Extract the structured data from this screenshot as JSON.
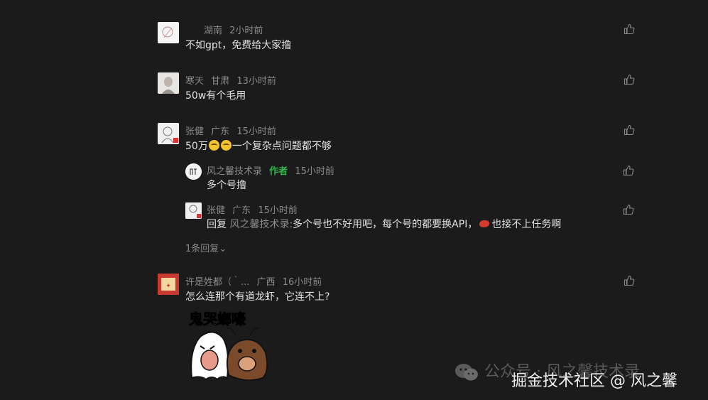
{
  "comments": [
    {
      "name": "",
      "region": "湖南",
      "time": "2小时前",
      "text": "不如gpt，免费给大家撸"
    },
    {
      "name": "寒天",
      "region": "甘肃",
      "time": "13小时前",
      "text": "50w有个毛用"
    },
    {
      "name": "张健",
      "region": "广东",
      "time": "15小时前",
      "text_before": "50万",
      "text_after": "一个复杂点问题都不够",
      "replies": [
        {
          "name": "风之馨技术录",
          "author_tag": "作者",
          "time": "15小时前",
          "text": "多个号撸"
        },
        {
          "name": "张健",
          "region": "广东",
          "time": "15小时前",
          "reply_prefix": "回复",
          "reply_to": "风之馨技术录:",
          "text_before": "多个号也不好用吧，每个号的都要换API，",
          "text_after": "也接不上任务啊"
        }
      ],
      "more_replies": "1条回复⌄"
    },
    {
      "name": "许是姓都（｀...",
      "region": "广西",
      "time": "16小时前",
      "text": "怎么连那个有道龙虾，它连不上?",
      "sticker_text": "鬼哭螂嚎"
    }
  ],
  "watermark": {
    "line1": "公众号 · 风之馨技术录",
    "line2": "掘金技术社区 @ 风之馨"
  },
  "colors": {
    "background": "#1b1b1b",
    "author_tag": "#2fb64b",
    "meta": "#8a8a8a",
    "text": "#e2e2e2"
  }
}
